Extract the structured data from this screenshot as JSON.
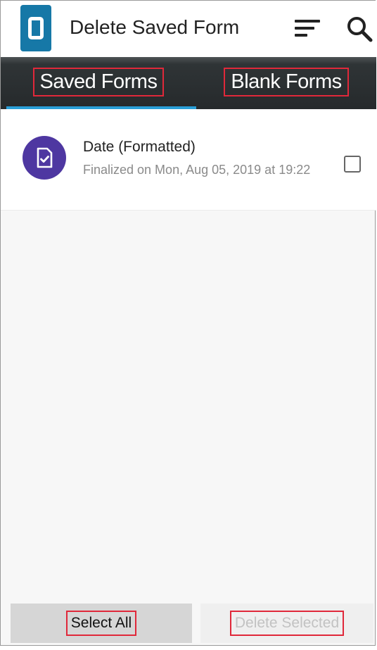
{
  "app_bar": {
    "title": "Delete Saved Form",
    "logo_icon": "odk-collect-logo",
    "sort_icon": "sort-icon",
    "search_icon": "search-icon"
  },
  "tabs": [
    {
      "label": "Saved Forms",
      "selected": true
    },
    {
      "label": "Blank Forms",
      "selected": false
    }
  ],
  "forms": [
    {
      "title": "Date (Formatted)",
      "subtitle": "Finalized on Mon, Aug 05, 2019 at 19:22",
      "icon": "finalized-form-icon",
      "checked": false
    }
  ],
  "buttons": {
    "select_all": "Select All",
    "delete_selected": "Delete Selected"
  },
  "colors": {
    "logo": "#1678a7",
    "tab_bar": "#262a2c",
    "tab_indicator": "#2a9fd8",
    "avatar": "#4e37a1",
    "highlight_box": "#e0283a"
  }
}
